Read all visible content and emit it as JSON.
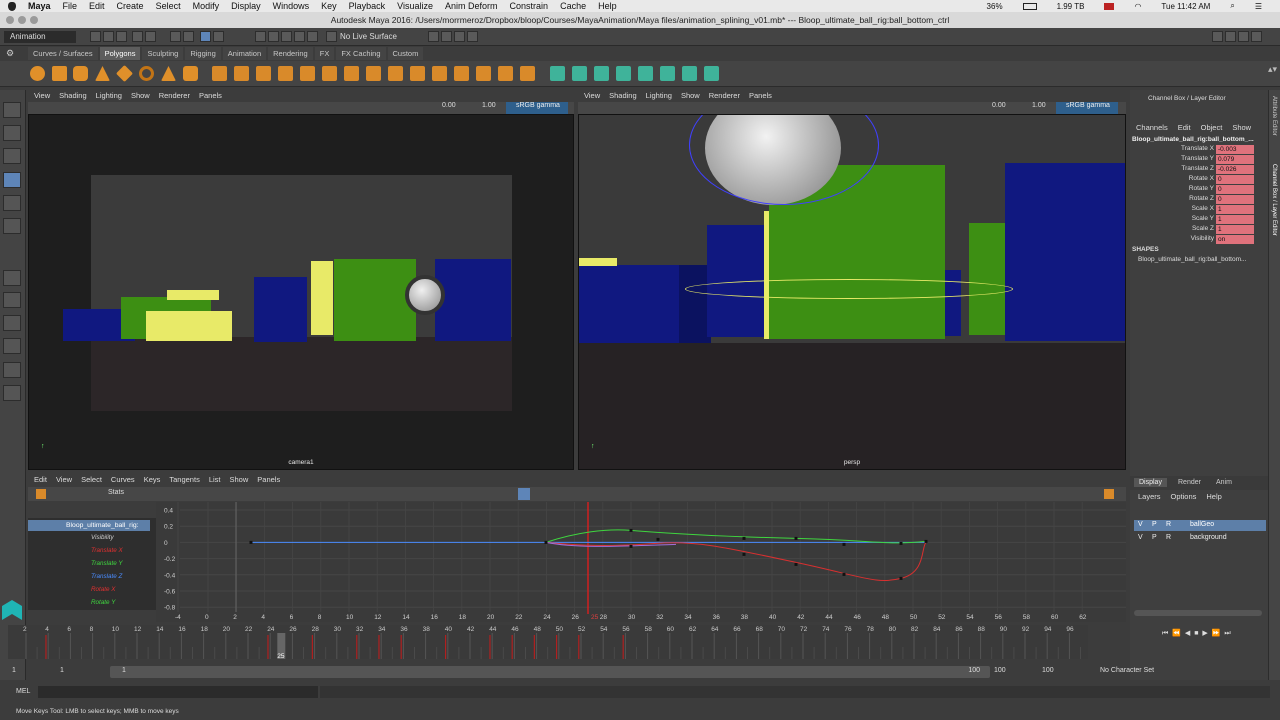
{
  "macmenu": {
    "apple": "",
    "app": "Maya",
    "items": [
      "File",
      "Edit",
      "Create",
      "Select",
      "Modify",
      "Display",
      "Windows",
      "Key",
      "Playback",
      "Visualize",
      "Anim Deform",
      "Constrain",
      "Cache",
      "Help"
    ],
    "battery": "36%",
    "disk": "1.99 TB",
    "clock": "Tue 11:42 AM"
  },
  "window_title": "Autodesk Maya 2016: /Users/morrmeroz/Dropbox/bloop/Courses/MayaAnimation/Maya files/animation_splining_v01.mb*  ---  Bloop_ultimate_ball_rig:ball_bottom_ctrl",
  "status": {
    "mode": "Animation",
    "live_surface": "No Live Surface"
  },
  "shelf_tabs": [
    "Curves / Surfaces",
    "Polygons",
    "Sculpting",
    "Rigging",
    "Animation",
    "Rendering",
    "FX",
    "FX Caching",
    "Custom"
  ],
  "shelf_active": "Polygons",
  "viewport_menu": [
    "View",
    "Shading",
    "Lighting",
    "Show",
    "Renderer",
    "Panels"
  ],
  "viewport_values": {
    "exposure": "0.00",
    "gamma": "1.00",
    "colorspace": "sRGB gamma"
  },
  "left_viewport": {
    "label": "camera1",
    "resolution": "1920 x 1080"
  },
  "right_viewport": {
    "label": "persp"
  },
  "channel_box": {
    "header": "Channel Box / Layer Editor",
    "menu": [
      "Channels",
      "Edit",
      "Object",
      "Show"
    ],
    "object": "Bloop_ultimate_ball_rig:ball_bottom_...",
    "attributes": [
      {
        "name": "Translate X",
        "value": "-0.003"
      },
      {
        "name": "Translate Y",
        "value": "0.079"
      },
      {
        "name": "Translate Z",
        "value": "-0.026"
      },
      {
        "name": "Rotate X",
        "value": "0"
      },
      {
        "name": "Rotate Y",
        "value": "0"
      },
      {
        "name": "Rotate Z",
        "value": "0"
      },
      {
        "name": "Scale X",
        "value": "1"
      },
      {
        "name": "Scale Y",
        "value": "1"
      },
      {
        "name": "Scale Z",
        "value": "1"
      },
      {
        "name": "Visibility",
        "value": "on"
      }
    ],
    "shapes_label": "SHAPES",
    "shape_name": "Bloop_ultimate_ball_rig:ball_bottom..."
  },
  "side_tabs": [
    "Attribute Editor",
    "Channel Box / Layer Editor"
  ],
  "layer_editor": {
    "tabs": [
      "Display",
      "Render",
      "Anim"
    ],
    "menu": [
      "Layers",
      "Options",
      "Help"
    ],
    "layers": [
      {
        "v": "V",
        "p": "P",
        "r": "R",
        "name": "ballGeo"
      },
      {
        "v": "V",
        "p": "P",
        "r": "R",
        "name": "background"
      }
    ]
  },
  "graph_editor": {
    "menu": [
      "Edit",
      "View",
      "Select",
      "Curves",
      "Keys",
      "Tangents",
      "List",
      "Show",
      "Panels"
    ],
    "stats": "Stats",
    "node": "Bloop_ultimate_ball_rig:",
    "curves": [
      {
        "name": "Visibility",
        "color": "#dddddd"
      },
      {
        "name": "Translate X",
        "color": "#e03030"
      },
      {
        "name": "Translate Y",
        "color": "#3fd63f"
      },
      {
        "name": "Translate Z",
        "color": "#4a8cff"
      },
      {
        "name": "Rotate X",
        "color": "#e03030"
      },
      {
        "name": "Rotate Y",
        "color": "#3fd63f"
      }
    ],
    "y_ticks": [
      "0.4",
      "0.2",
      "0",
      "-0.2",
      "-0.4",
      "-0.6",
      "-0.8"
    ],
    "x_ticks": [
      "-4",
      "0",
      "2",
      "4",
      "6",
      "8",
      "10",
      "12",
      "14",
      "16",
      "18",
      "20",
      "22",
      "24",
      "26",
      "28",
      "30",
      "32",
      "34",
      "36",
      "38",
      "40",
      "42",
      "44",
      "46",
      "48",
      "50",
      "52",
      "54",
      "56",
      "58",
      "60",
      "62"
    ],
    "current_frame": "25"
  },
  "timeline": {
    "ticks": [
      "2",
      "4",
      "6",
      "8",
      "10",
      "12",
      "14",
      "16",
      "18",
      "20",
      "22",
      "24",
      "26",
      "28",
      "30",
      "32",
      "34",
      "36",
      "38",
      "40",
      "42",
      "44",
      "46",
      "48",
      "50",
      "52",
      "54",
      "56",
      "58",
      "60",
      "62",
      "64",
      "66",
      "68",
      "70",
      "72",
      "74",
      "76",
      "78",
      "80",
      "82",
      "84",
      "86",
      "88",
      "90",
      "92",
      "94",
      "96"
    ],
    "current": "25",
    "range_start": "1",
    "range_start2": "1",
    "range_inner_start": "1",
    "range_inner_end": "100",
    "range_end": "100",
    "range_end2": "100",
    "char_set": "No Character Set"
  },
  "command_line": {
    "lang": "MEL"
  },
  "help_line": "Move Keys Tool: LMB to select keys; MMB to move keys"
}
